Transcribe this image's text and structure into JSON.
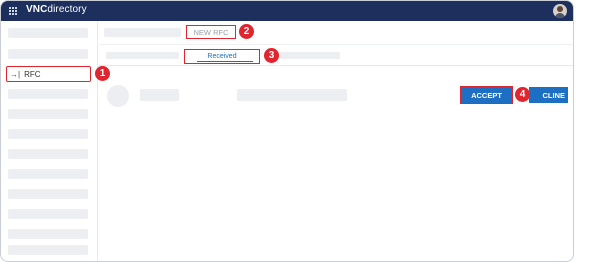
{
  "app": {
    "brand_bold": "VNC",
    "brand_rest": "directory"
  },
  "sidebar": {
    "rfc_label": "RFC",
    "rfc_icon": "arrow-right-bar-icon"
  },
  "toolbar": {
    "new_rfc_label": "NEW RFC"
  },
  "tabs": {
    "received_label": "Received"
  },
  "actions": {
    "accept_label": "ACCEPT",
    "decline_label": "CLINE"
  },
  "callouts": {
    "one": "1",
    "two": "2",
    "three": "3",
    "four": "4"
  },
  "colors": {
    "topbar": "#1d2f5c",
    "accent": "#1d6fc4",
    "highlight": "#e1252f"
  }
}
